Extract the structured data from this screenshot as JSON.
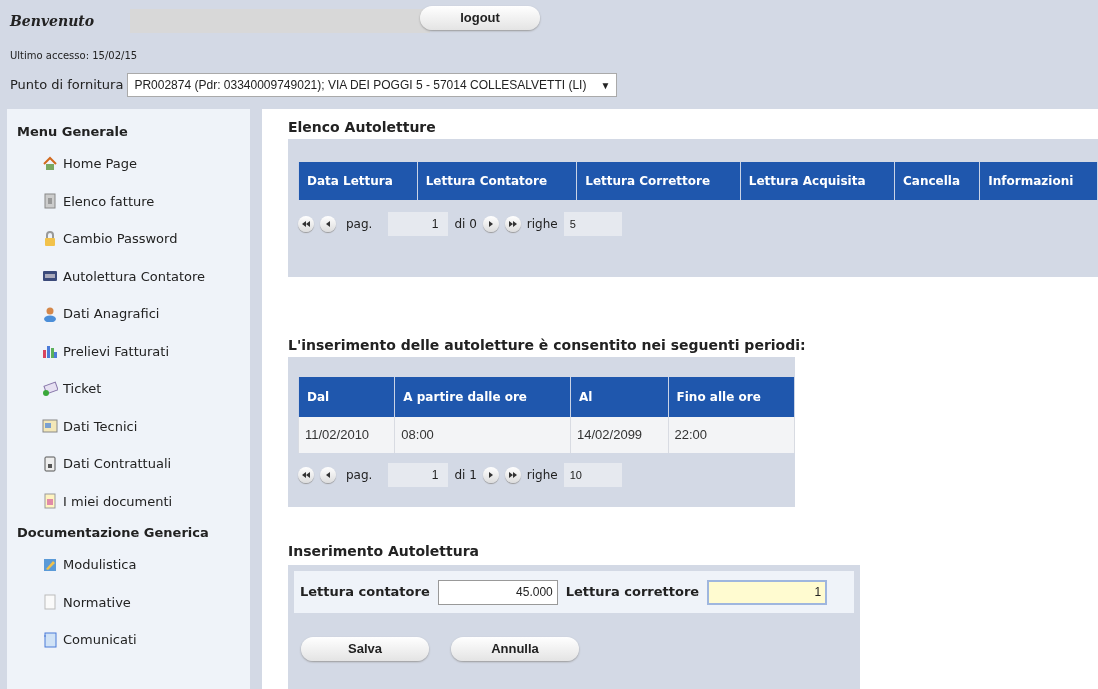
{
  "header": {
    "welcome": "Benvenuto",
    "logout_button": "logout",
    "last_access": "Ultimo accesso: 15/02/15",
    "supply_point_label": "Punto di fornitura",
    "supply_point_value": "PR002874 (Pdr: 03340009749021); VIA DEI POGGI 5 - 57014 COLLESALVETTI (LI)",
    "dropdown_arrow": "▼"
  },
  "sidebar": {
    "sections": [
      {
        "title": "Menu Generale",
        "items": [
          {
            "label": "Home Page"
          },
          {
            "label": "Elenco fatture"
          },
          {
            "label": "Cambio Password"
          },
          {
            "label": "Autolettura Contatore"
          },
          {
            "label": "Dati Anagrafici"
          },
          {
            "label": "Prelievi Fatturati"
          },
          {
            "label": "Ticket"
          },
          {
            "label": "Dati Tecnici"
          },
          {
            "label": "Dati Contrattuali"
          },
          {
            "label": "I miei documenti"
          }
        ]
      },
      {
        "title": "Documentazione Generica",
        "items": [
          {
            "label": "Modulistica"
          },
          {
            "label": "Normative"
          },
          {
            "label": "Comunicati"
          }
        ]
      }
    ]
  },
  "readings": {
    "title": "Elenco Autoletture",
    "table": {
      "columns": [
        "Data Lettura",
        "Lettura Contatore",
        "Lettura Correttore",
        "Lettura Acquisita",
        "Cancella",
        "Informazioni"
      ]
    },
    "pager": {
      "page_label": "pag.",
      "page": "1",
      "of": "di 0",
      "rows_label": "righe",
      "rows": "5"
    }
  },
  "periods": {
    "title": "L'inserimento delle autoletture è consentito nei seguenti periodi:",
    "table": {
      "columns": [
        "Dal",
        "A partire dalle ore",
        "Al",
        "Fino alle ore"
      ],
      "rows": [
        [
          "11/02/2010",
          "08:00",
          "14/02/2099",
          "22:00"
        ]
      ]
    },
    "pager": {
      "page_label": "pag.",
      "page": "1",
      "of": "di 1",
      "rows_label": "righe",
      "rows": "10"
    }
  },
  "entry": {
    "title": "Inserimento Autolettura",
    "fields": [
      {
        "label": "Lettura contatore",
        "value": "45.000",
        "focused": false
      },
      {
        "label": "Lettura correttore",
        "value": "1",
        "focused": true
      }
    ],
    "buttons": [
      "Salva",
      "Annulla"
    ]
  }
}
